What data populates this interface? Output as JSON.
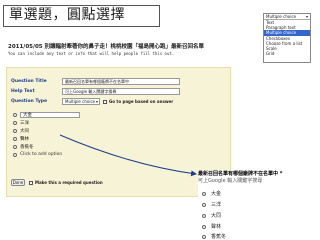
{
  "slide_title": "單選題，圓點選擇",
  "question_type_dropdown": {
    "selected": "Multiple choice",
    "options": [
      "Text",
      "Paragraph text",
      "Multiple choice",
      "Checkboxes",
      "Choose from a list",
      "Scale",
      "Grid"
    ],
    "highlighted": "Multiple choice"
  },
  "form": {
    "title": "2011/05/05 別讓輻射牽著你的鼻子走！桃桃校園「福島開心跑」最新召回名單",
    "description": "You can include any text or info that will help people fill this out."
  },
  "editor": {
    "question_title_label": "Question Title",
    "question_title_value": "最新召回名單有哪個廠牌不在名單中",
    "help_text_label": "Help Text",
    "help_text_value": "可上Google 輸入關鍵字搜尋",
    "question_type_label": "Question Type",
    "question_type_value": "Multiple choice",
    "go_to_page_label": "Go to page based on answer",
    "options": [
      "大金",
      "三洋",
      "大同",
      "聲林",
      "香蕉冬"
    ],
    "add_other": "Click to add option",
    "done_label": "Done",
    "required_label": "Make this a required question"
  },
  "preview": {
    "question": "最新召回名單有哪個廠牌不在名單中 *",
    "help": "可上Google 輸入關鍵字搜尋",
    "options": [
      "大金",
      "三洋",
      "大同",
      "聲林",
      "香蕉冬"
    ]
  },
  "colors": {
    "editor_bg": "#f7f3d6",
    "label_blue": "#1a3e8c",
    "highlight": "#3366cc"
  }
}
